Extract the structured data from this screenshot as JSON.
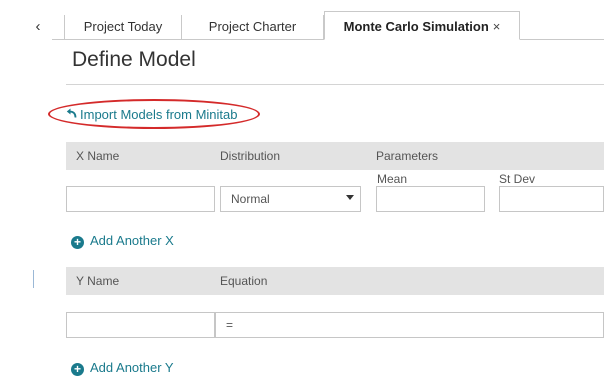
{
  "nav": {
    "collapse_glyph": "‹"
  },
  "tabs": [
    {
      "label": "Project Today"
    },
    {
      "label": "Project Charter"
    },
    {
      "label": "Monte Carlo Simulation",
      "close_glyph": "×",
      "active": true
    }
  ],
  "page": {
    "title": "Define Model",
    "import_link": "Import Models from Minitab",
    "import_icon": "undo-arrow-icon",
    "highlight_color": "#d42a2a"
  },
  "x_section": {
    "headers": {
      "name": "X Name",
      "distribution": "Distribution",
      "parameters": "Parameters"
    },
    "param_labels": {
      "mean": "Mean",
      "stdev": "St Dev"
    },
    "row": {
      "name_value": "",
      "distribution_value": "Normal",
      "mean_value": "",
      "stdev_value": ""
    },
    "add_label": "Add Another X"
  },
  "y_section": {
    "headers": {
      "name": "Y Name",
      "equation": "Equation"
    },
    "row": {
      "name_value": "",
      "equation_value": "="
    },
    "add_label": "Add Another Y"
  },
  "colors": {
    "accent": "#1a7a8c",
    "header_bg": "#e3e3e3"
  }
}
